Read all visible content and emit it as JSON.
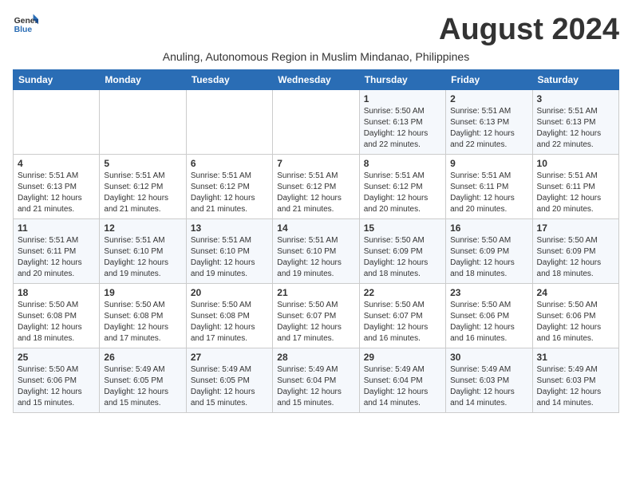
{
  "logo": {
    "line1": "General",
    "line2": "Blue"
  },
  "title": "August 2024",
  "subtitle": "Anuling, Autonomous Region in Muslim Mindanao, Philippines",
  "days_header": [
    "Sunday",
    "Monday",
    "Tuesday",
    "Wednesday",
    "Thursday",
    "Friday",
    "Saturday"
  ],
  "weeks": [
    [
      {
        "day": "",
        "detail": ""
      },
      {
        "day": "",
        "detail": ""
      },
      {
        "day": "",
        "detail": ""
      },
      {
        "day": "",
        "detail": ""
      },
      {
        "day": "1",
        "detail": "Sunrise: 5:50 AM\nSunset: 6:13 PM\nDaylight: 12 hours\nand 22 minutes."
      },
      {
        "day": "2",
        "detail": "Sunrise: 5:51 AM\nSunset: 6:13 PM\nDaylight: 12 hours\nand 22 minutes."
      },
      {
        "day": "3",
        "detail": "Sunrise: 5:51 AM\nSunset: 6:13 PM\nDaylight: 12 hours\nand 22 minutes."
      }
    ],
    [
      {
        "day": "4",
        "detail": "Sunrise: 5:51 AM\nSunset: 6:13 PM\nDaylight: 12 hours\nand 21 minutes."
      },
      {
        "day": "5",
        "detail": "Sunrise: 5:51 AM\nSunset: 6:12 PM\nDaylight: 12 hours\nand 21 minutes."
      },
      {
        "day": "6",
        "detail": "Sunrise: 5:51 AM\nSunset: 6:12 PM\nDaylight: 12 hours\nand 21 minutes."
      },
      {
        "day": "7",
        "detail": "Sunrise: 5:51 AM\nSunset: 6:12 PM\nDaylight: 12 hours\nand 21 minutes."
      },
      {
        "day": "8",
        "detail": "Sunrise: 5:51 AM\nSunset: 6:12 PM\nDaylight: 12 hours\nand 20 minutes."
      },
      {
        "day": "9",
        "detail": "Sunrise: 5:51 AM\nSunset: 6:11 PM\nDaylight: 12 hours\nand 20 minutes."
      },
      {
        "day": "10",
        "detail": "Sunrise: 5:51 AM\nSunset: 6:11 PM\nDaylight: 12 hours\nand 20 minutes."
      }
    ],
    [
      {
        "day": "11",
        "detail": "Sunrise: 5:51 AM\nSunset: 6:11 PM\nDaylight: 12 hours\nand 20 minutes."
      },
      {
        "day": "12",
        "detail": "Sunrise: 5:51 AM\nSunset: 6:10 PM\nDaylight: 12 hours\nand 19 minutes."
      },
      {
        "day": "13",
        "detail": "Sunrise: 5:51 AM\nSunset: 6:10 PM\nDaylight: 12 hours\nand 19 minutes."
      },
      {
        "day": "14",
        "detail": "Sunrise: 5:51 AM\nSunset: 6:10 PM\nDaylight: 12 hours\nand 19 minutes."
      },
      {
        "day": "15",
        "detail": "Sunrise: 5:50 AM\nSunset: 6:09 PM\nDaylight: 12 hours\nand 18 minutes."
      },
      {
        "day": "16",
        "detail": "Sunrise: 5:50 AM\nSunset: 6:09 PM\nDaylight: 12 hours\nand 18 minutes."
      },
      {
        "day": "17",
        "detail": "Sunrise: 5:50 AM\nSunset: 6:09 PM\nDaylight: 12 hours\nand 18 minutes."
      }
    ],
    [
      {
        "day": "18",
        "detail": "Sunrise: 5:50 AM\nSunset: 6:08 PM\nDaylight: 12 hours\nand 18 minutes."
      },
      {
        "day": "19",
        "detail": "Sunrise: 5:50 AM\nSunset: 6:08 PM\nDaylight: 12 hours\nand 17 minutes."
      },
      {
        "day": "20",
        "detail": "Sunrise: 5:50 AM\nSunset: 6:08 PM\nDaylight: 12 hours\nand 17 minutes."
      },
      {
        "day": "21",
        "detail": "Sunrise: 5:50 AM\nSunset: 6:07 PM\nDaylight: 12 hours\nand 17 minutes."
      },
      {
        "day": "22",
        "detail": "Sunrise: 5:50 AM\nSunset: 6:07 PM\nDaylight: 12 hours\nand 16 minutes."
      },
      {
        "day": "23",
        "detail": "Sunrise: 5:50 AM\nSunset: 6:06 PM\nDaylight: 12 hours\nand 16 minutes."
      },
      {
        "day": "24",
        "detail": "Sunrise: 5:50 AM\nSunset: 6:06 PM\nDaylight: 12 hours\nand 16 minutes."
      }
    ],
    [
      {
        "day": "25",
        "detail": "Sunrise: 5:50 AM\nSunset: 6:06 PM\nDaylight: 12 hours\nand 15 minutes."
      },
      {
        "day": "26",
        "detail": "Sunrise: 5:49 AM\nSunset: 6:05 PM\nDaylight: 12 hours\nand 15 minutes."
      },
      {
        "day": "27",
        "detail": "Sunrise: 5:49 AM\nSunset: 6:05 PM\nDaylight: 12 hours\nand 15 minutes."
      },
      {
        "day": "28",
        "detail": "Sunrise: 5:49 AM\nSunset: 6:04 PM\nDaylight: 12 hours\nand 15 minutes."
      },
      {
        "day": "29",
        "detail": "Sunrise: 5:49 AM\nSunset: 6:04 PM\nDaylight: 12 hours\nand 14 minutes."
      },
      {
        "day": "30",
        "detail": "Sunrise: 5:49 AM\nSunset: 6:03 PM\nDaylight: 12 hours\nand 14 minutes."
      },
      {
        "day": "31",
        "detail": "Sunrise: 5:49 AM\nSunset: 6:03 PM\nDaylight: 12 hours\nand 14 minutes."
      }
    ]
  ]
}
